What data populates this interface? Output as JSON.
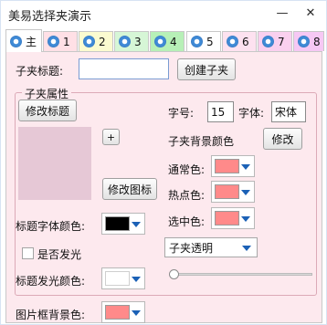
{
  "window": {
    "title": "美易选择夹演示",
    "minimize_glyph": "—",
    "close_glyph": "✕"
  },
  "tabs": [
    {
      "label": "主",
      "color": "#ffffff"
    },
    {
      "label": "1",
      "color": "#ffe0e6"
    },
    {
      "label": "2",
      "color": "#fbfbd0"
    },
    {
      "label": "3",
      "color": "#d6f6d6"
    },
    {
      "label": "4",
      "color": "#b7f0b7"
    },
    {
      "label": "5",
      "color": "#ffffff"
    },
    {
      "label": "6",
      "color": "#fde2f0"
    },
    {
      "label": "7",
      "color": "#fad0ef"
    },
    {
      "label": "8",
      "color": "#f6c8f4"
    }
  ],
  "form": {
    "tab_title_label": "子夹标题:",
    "tab_title_value": "",
    "create_tab_button": "创建子夹",
    "group_legend": "子夹属性",
    "modify_title_button": "修改标题",
    "plus_button": "+",
    "modify_icon_button": "修改图标",
    "font_size_label": "字号:",
    "font_size_value": "15",
    "font_label": "字体:",
    "font_value": "宋体",
    "tab_bg_color_label": "子夹背景颜色",
    "modify_button": "修改",
    "normal_color_label": "通常色:",
    "hot_color_label": "热点色:",
    "selected_color_label": "选中色:",
    "title_font_color_label": "标题字体颜色:",
    "glow_checkbox_label": "是否发光",
    "title_glow_color_label": "标题发光颜色:",
    "transparency_select": "子夹透明",
    "picture_bg_label": "图片框背景色:"
  },
  "colors": {
    "accent": "#1b61b6",
    "panel_bg": "#fde9ee",
    "normal_color": "#ff8a8a",
    "hot_color": "#ff8a8a",
    "selected_color": "#ff8a8a",
    "title_font_color": "#000000",
    "title_glow_color": "#ffffff",
    "picture_bg_color": "#ff8a8a"
  },
  "slider": {
    "value": 0
  }
}
